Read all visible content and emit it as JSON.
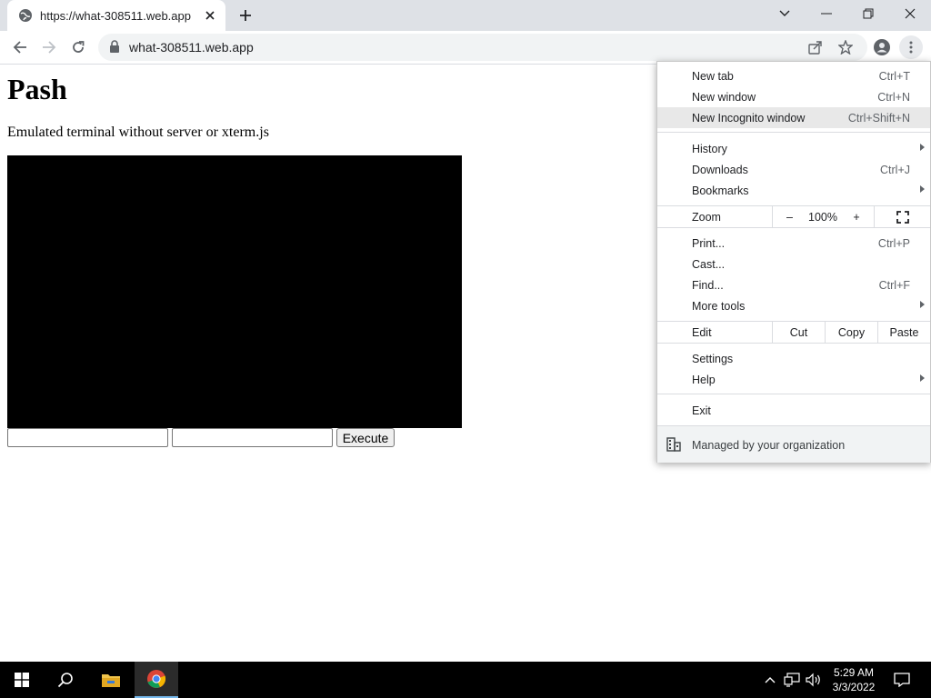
{
  "browser": {
    "tab_title": "https://what-308511.web.app",
    "url": "what-308511.web.app"
  },
  "page": {
    "heading": "Pash",
    "subtitle": "Emulated terminal without server or xterm.js",
    "input1_value": "",
    "input2_value": "",
    "execute_label": "Execute"
  },
  "menu": {
    "new_tab": {
      "label": "New tab",
      "shortcut": "Ctrl+T"
    },
    "new_window": {
      "label": "New window",
      "shortcut": "Ctrl+N"
    },
    "new_incognito": {
      "label": "New Incognito window",
      "shortcut": "Ctrl+Shift+N"
    },
    "history": {
      "label": "History"
    },
    "downloads": {
      "label": "Downloads",
      "shortcut": "Ctrl+J"
    },
    "bookmarks": {
      "label": "Bookmarks"
    },
    "zoom": {
      "label": "Zoom",
      "minus": "–",
      "value": "100%",
      "plus": "+"
    },
    "print": {
      "label": "Print...",
      "shortcut": "Ctrl+P"
    },
    "cast": {
      "label": "Cast..."
    },
    "find": {
      "label": "Find...",
      "shortcut": "Ctrl+F"
    },
    "more_tools": {
      "label": "More tools"
    },
    "edit": {
      "label": "Edit",
      "cut": "Cut",
      "copy": "Copy",
      "paste": "Paste"
    },
    "settings": {
      "label": "Settings"
    },
    "help": {
      "label": "Help"
    },
    "exit": {
      "label": "Exit"
    },
    "managed": {
      "label": "Managed by your organization"
    }
  },
  "taskbar": {
    "time": "5:29 AM",
    "date": "3/3/2022"
  },
  "colors": {
    "terminal_bg": "#000000",
    "tabstrip_bg": "#dee1e6",
    "taskbar_bg": "#000000",
    "highlight": "#e8e8e8"
  },
  "icons": [
    "globe-icon",
    "close-icon",
    "plus-icon",
    "chevron-down-icon",
    "minimize-icon",
    "restore-icon",
    "back-icon",
    "forward-icon",
    "reload-icon",
    "lock-icon",
    "share-icon",
    "star-icon",
    "profile-icon",
    "kebab-icon",
    "fullscreen-icon",
    "building-icon",
    "windows-start-icon",
    "search-icon",
    "file-explorer-icon",
    "chrome-icon",
    "chevron-up-icon",
    "network-icon",
    "volume-icon",
    "notification-icon"
  ]
}
